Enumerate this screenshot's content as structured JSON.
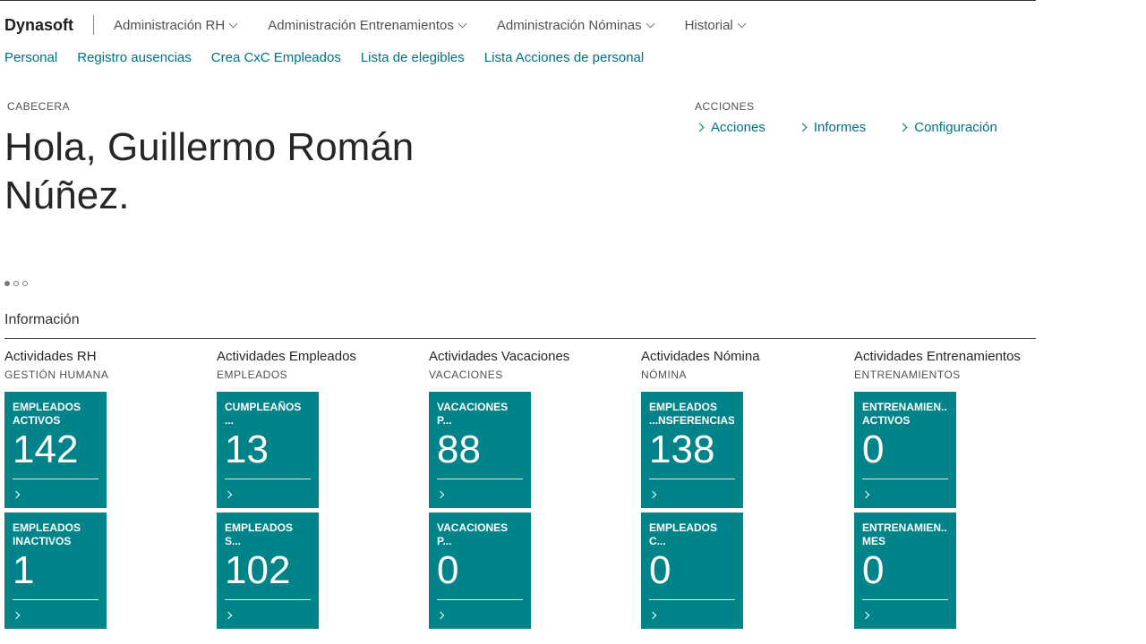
{
  "nav": {
    "brand": "Dynasoft",
    "menus": [
      "Administración RH",
      "Administración Entrenamientos",
      "Administración Nóminas",
      "Historial"
    ]
  },
  "subnav": [
    "Personal",
    "Registro ausencias",
    "Crea CxC Empleados",
    "Lista de elegibles",
    "Lista Acciones de personal"
  ],
  "header": {
    "caption": "CABECERA",
    "greeting": "Hola, Guillermo Román Núñez."
  },
  "actions": {
    "caption": "ACCIONES",
    "items": [
      "Acciones",
      "Informes",
      "Configuración"
    ]
  },
  "info": {
    "title": "Información",
    "groups": [
      {
        "title": "Actividades RH",
        "subtitle": "GESTIÓN HUMANA",
        "tiles": [
          {
            "label": "EMPLEADOS\nACTIVOS",
            "value": "142"
          },
          {
            "label": "EMPLEADOS\nINACTIVOS",
            "value": "1"
          }
        ]
      },
      {
        "title": "Actividades Empleados",
        "subtitle": "EMPLEADOS",
        "tiles": [
          {
            "label": "CUMPLEAÑOS ...\nMES",
            "value": "13"
          },
          {
            "label": "EMPLEADOS S...\nMASCULINO",
            "value": "102"
          }
        ]
      },
      {
        "title": "Actividades Vacaciones",
        "subtitle": "VACACIONES",
        "tiles": [
          {
            "label": "VACACIONES P...\nVENCER",
            "value": "88"
          },
          {
            "label": "VACACIONES P...\nINICIAR",
            "value": "0"
          }
        ]
      },
      {
        "title": "Actividades Nómina",
        "subtitle": "NÓMINA",
        "tiles": [
          {
            "label": "EMPLEADOS\n...NSFERENCIAS",
            "value": "138"
          },
          {
            "label": "EMPLEADOS C...\nX CHEQUES",
            "value": "0"
          }
        ]
      },
      {
        "title": "Actividades Entrenamientos",
        "subtitle": "ENTRENAMIENTOS",
        "tiles": [
          {
            "label": "ENTRENAMIEN...\nACTIVOS",
            "value": "0"
          },
          {
            "label": "ENTRENAMIEN...\nMES",
            "value": "0"
          }
        ]
      }
    ]
  },
  "theme": {
    "tile_color": "#008489",
    "link_color": "#00727e"
  }
}
